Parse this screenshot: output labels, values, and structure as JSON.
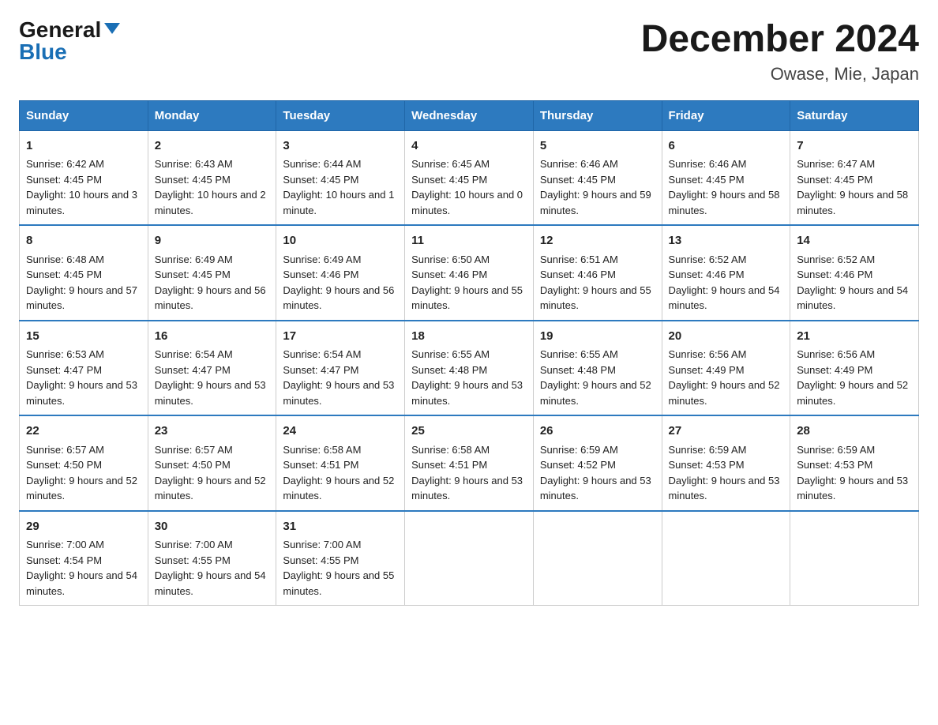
{
  "logo": {
    "general": "General",
    "blue": "Blue"
  },
  "header": {
    "month_title": "December 2024",
    "location": "Owase, Mie, Japan"
  },
  "days_of_week": [
    "Sunday",
    "Monday",
    "Tuesday",
    "Wednesday",
    "Thursday",
    "Friday",
    "Saturday"
  ],
  "weeks": [
    [
      {
        "day": "1",
        "sunrise": "6:42 AM",
        "sunset": "4:45 PM",
        "daylight": "10 hours and 3 minutes."
      },
      {
        "day": "2",
        "sunrise": "6:43 AM",
        "sunset": "4:45 PM",
        "daylight": "10 hours and 2 minutes."
      },
      {
        "day": "3",
        "sunrise": "6:44 AM",
        "sunset": "4:45 PM",
        "daylight": "10 hours and 1 minute."
      },
      {
        "day": "4",
        "sunrise": "6:45 AM",
        "sunset": "4:45 PM",
        "daylight": "10 hours and 0 minutes."
      },
      {
        "day": "5",
        "sunrise": "6:46 AM",
        "sunset": "4:45 PM",
        "daylight": "9 hours and 59 minutes."
      },
      {
        "day": "6",
        "sunrise": "6:46 AM",
        "sunset": "4:45 PM",
        "daylight": "9 hours and 58 minutes."
      },
      {
        "day": "7",
        "sunrise": "6:47 AM",
        "sunset": "4:45 PM",
        "daylight": "9 hours and 58 minutes."
      }
    ],
    [
      {
        "day": "8",
        "sunrise": "6:48 AM",
        "sunset": "4:45 PM",
        "daylight": "9 hours and 57 minutes."
      },
      {
        "day": "9",
        "sunrise": "6:49 AM",
        "sunset": "4:45 PM",
        "daylight": "9 hours and 56 minutes."
      },
      {
        "day": "10",
        "sunrise": "6:49 AM",
        "sunset": "4:46 PM",
        "daylight": "9 hours and 56 minutes."
      },
      {
        "day": "11",
        "sunrise": "6:50 AM",
        "sunset": "4:46 PM",
        "daylight": "9 hours and 55 minutes."
      },
      {
        "day": "12",
        "sunrise": "6:51 AM",
        "sunset": "4:46 PM",
        "daylight": "9 hours and 55 minutes."
      },
      {
        "day": "13",
        "sunrise": "6:52 AM",
        "sunset": "4:46 PM",
        "daylight": "9 hours and 54 minutes."
      },
      {
        "day": "14",
        "sunrise": "6:52 AM",
        "sunset": "4:46 PM",
        "daylight": "9 hours and 54 minutes."
      }
    ],
    [
      {
        "day": "15",
        "sunrise": "6:53 AM",
        "sunset": "4:47 PM",
        "daylight": "9 hours and 53 minutes."
      },
      {
        "day": "16",
        "sunrise": "6:54 AM",
        "sunset": "4:47 PM",
        "daylight": "9 hours and 53 minutes."
      },
      {
        "day": "17",
        "sunrise": "6:54 AM",
        "sunset": "4:47 PM",
        "daylight": "9 hours and 53 minutes."
      },
      {
        "day": "18",
        "sunrise": "6:55 AM",
        "sunset": "4:48 PM",
        "daylight": "9 hours and 53 minutes."
      },
      {
        "day": "19",
        "sunrise": "6:55 AM",
        "sunset": "4:48 PM",
        "daylight": "9 hours and 52 minutes."
      },
      {
        "day": "20",
        "sunrise": "6:56 AM",
        "sunset": "4:49 PM",
        "daylight": "9 hours and 52 minutes."
      },
      {
        "day": "21",
        "sunrise": "6:56 AM",
        "sunset": "4:49 PM",
        "daylight": "9 hours and 52 minutes."
      }
    ],
    [
      {
        "day": "22",
        "sunrise": "6:57 AM",
        "sunset": "4:50 PM",
        "daylight": "9 hours and 52 minutes."
      },
      {
        "day": "23",
        "sunrise": "6:57 AM",
        "sunset": "4:50 PM",
        "daylight": "9 hours and 52 minutes."
      },
      {
        "day": "24",
        "sunrise": "6:58 AM",
        "sunset": "4:51 PM",
        "daylight": "9 hours and 52 minutes."
      },
      {
        "day": "25",
        "sunrise": "6:58 AM",
        "sunset": "4:51 PM",
        "daylight": "9 hours and 53 minutes."
      },
      {
        "day": "26",
        "sunrise": "6:59 AM",
        "sunset": "4:52 PM",
        "daylight": "9 hours and 53 minutes."
      },
      {
        "day": "27",
        "sunrise": "6:59 AM",
        "sunset": "4:53 PM",
        "daylight": "9 hours and 53 minutes."
      },
      {
        "day": "28",
        "sunrise": "6:59 AM",
        "sunset": "4:53 PM",
        "daylight": "9 hours and 53 minutes."
      }
    ],
    [
      {
        "day": "29",
        "sunrise": "7:00 AM",
        "sunset": "4:54 PM",
        "daylight": "9 hours and 54 minutes."
      },
      {
        "day": "30",
        "sunrise": "7:00 AM",
        "sunset": "4:55 PM",
        "daylight": "9 hours and 54 minutes."
      },
      {
        "day": "31",
        "sunrise": "7:00 AM",
        "sunset": "4:55 PM",
        "daylight": "9 hours and 55 minutes."
      },
      null,
      null,
      null,
      null
    ]
  ],
  "labels": {
    "sunrise": "Sunrise:",
    "sunset": "Sunset:",
    "daylight": "Daylight:"
  },
  "colors": {
    "header_bg": "#2d7abf",
    "header_text": "#ffffff",
    "border": "#aaaaaa"
  }
}
